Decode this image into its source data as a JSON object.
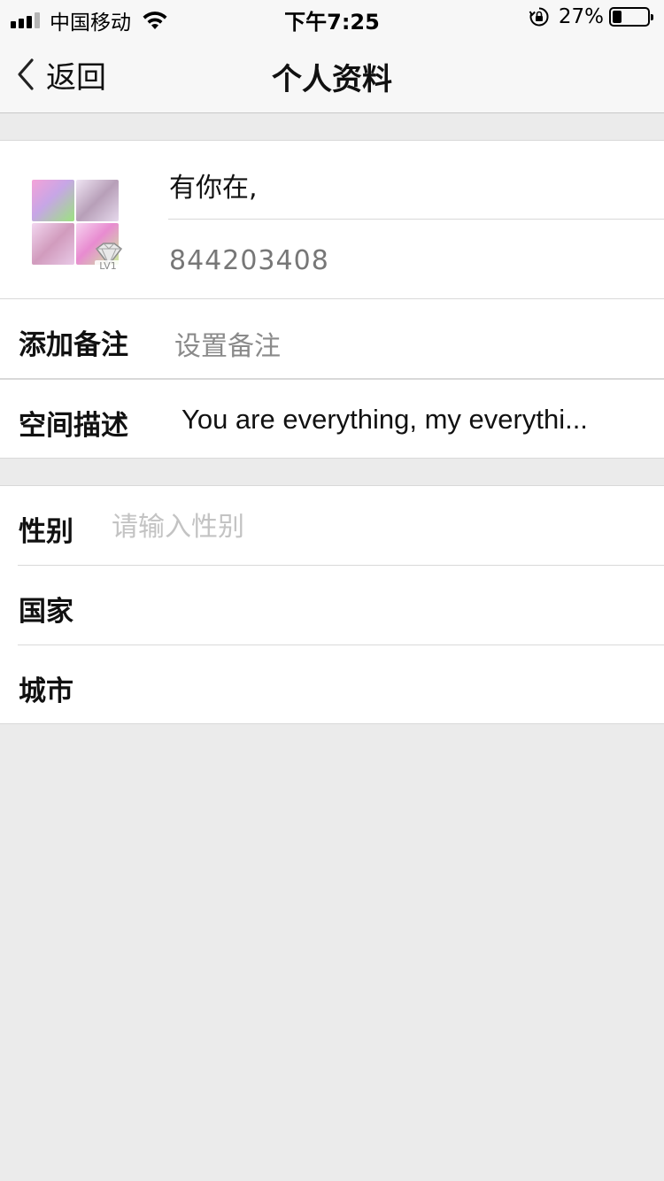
{
  "status_bar": {
    "carrier": "中国移动",
    "time": "下午7:25",
    "battery_percent": "27%",
    "battery_level": 0.27
  },
  "nav": {
    "back_label": "返回",
    "title": "个人资料"
  },
  "profile": {
    "nickname": "有你在,",
    "qq_number": "844203408",
    "level_badge": "LV1"
  },
  "remark": {
    "label": "添加备注",
    "value": "设置备注"
  },
  "description": {
    "label": "空间描述",
    "value": "You are everything, my everythi..."
  },
  "details": {
    "gender_label": "性别",
    "gender_placeholder": "请输入性别",
    "country_label": "国家",
    "city_label": "城市"
  },
  "colors": {
    "background": "#ebebeb",
    "bar": "#f7f7f7",
    "placeholder": "#c3c3c3",
    "secondary_text": "#8a8a8a"
  }
}
